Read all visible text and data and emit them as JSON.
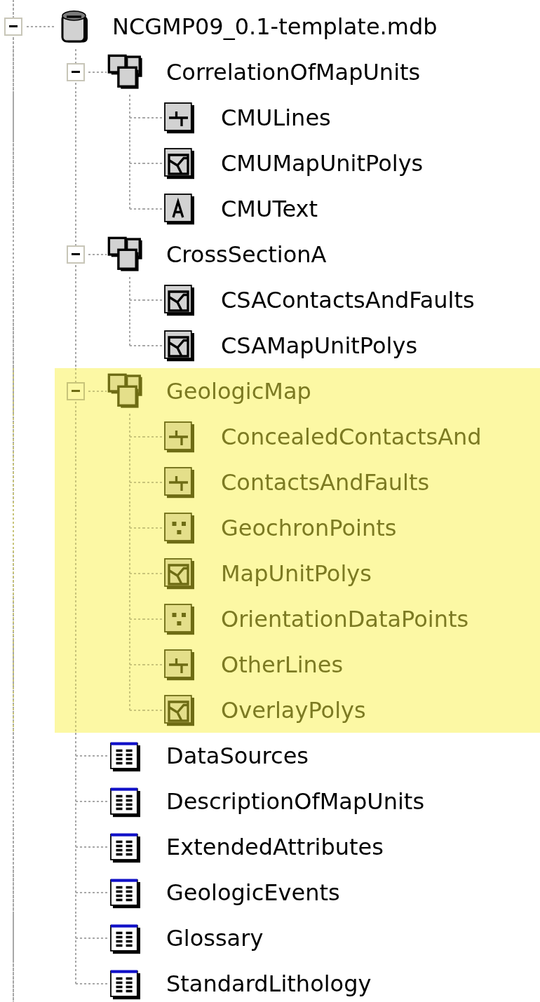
{
  "tree": {
    "label": "NCGMP09_0.1-template.mdb",
    "kind": "database",
    "expanded": true,
    "children": [
      {
        "label": "CorrelationOfMapUnits",
        "kind": "feature-dataset",
        "expanded": true,
        "highlighted": false,
        "children": [
          {
            "label": "CMULines",
            "kind": "line-class"
          },
          {
            "label": "CMUMapUnitPolys",
            "kind": "polygon-class"
          },
          {
            "label": "CMUText",
            "kind": "annotation-class"
          }
        ]
      },
      {
        "label": "CrossSectionA",
        "kind": "feature-dataset",
        "expanded": true,
        "highlighted": false,
        "children": [
          {
            "label": "CSAContactsAndFaults",
            "kind": "polygon-class"
          },
          {
            "label": "CSAMapUnitPolys",
            "kind": "polygon-class"
          }
        ]
      },
      {
        "label": "GeologicMap",
        "kind": "feature-dataset",
        "expanded": true,
        "highlighted": true,
        "children": [
          {
            "label": "ConcealedContactsAnd",
            "kind": "line-class"
          },
          {
            "label": "ContactsAndFaults",
            "kind": "line-class"
          },
          {
            "label": "GeochronPoints",
            "kind": "point-class"
          },
          {
            "label": "MapUnitPolys",
            "kind": "polygon-class"
          },
          {
            "label": "OrientationDataPoints",
            "kind": "point-class"
          },
          {
            "label": "OtherLines",
            "kind": "line-class"
          },
          {
            "label": "OverlayPolys",
            "kind": "polygon-class"
          }
        ]
      },
      {
        "label": "DataSources",
        "kind": "table"
      },
      {
        "label": "DescriptionOfMapUnits",
        "kind": "table"
      },
      {
        "label": "ExtendedAttributes",
        "kind": "table"
      },
      {
        "label": "GeologicEvents",
        "kind": "table"
      },
      {
        "label": "Glossary",
        "kind": "table"
      },
      {
        "label": "StandardLithology",
        "kind": "table"
      }
    ]
  }
}
